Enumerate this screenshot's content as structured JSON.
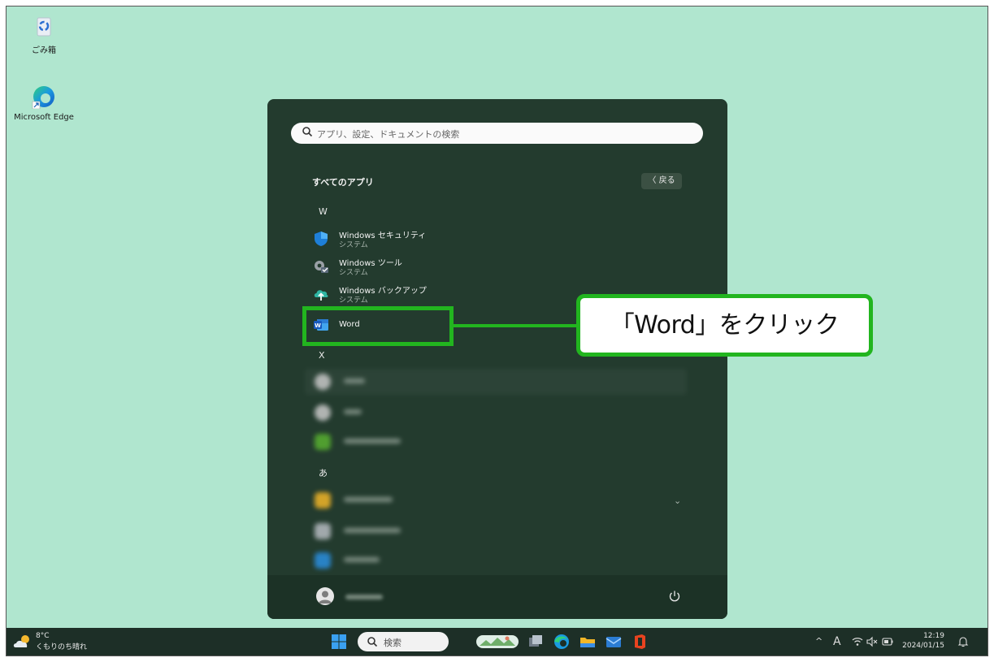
{
  "desktop": {
    "recycle_bin_label": "ごみ箱",
    "edge_label": "Microsoft Edge"
  },
  "start_menu": {
    "search_placeholder": "アプリ、設定、ドキュメントの検索",
    "all_apps_title": "すべてのアプリ",
    "back_label": "〈  戻る",
    "letters": [
      "W",
      "X",
      "あ"
    ],
    "apps": [
      {
        "name": "Windows セキュリティ",
        "sub": "システム"
      },
      {
        "name": "Windows ツール",
        "sub": "システム"
      },
      {
        "name": "Windows バックアップ",
        "sub": "システム"
      },
      {
        "name": "Word",
        "sub": ""
      }
    ]
  },
  "annotation": {
    "callout_text": "「Word」をクリック",
    "color": "#22b51f"
  },
  "taskbar": {
    "temperature": "8°C",
    "weather": "くもりのち晴れ",
    "search_label": "検索",
    "ime": "A",
    "time": "12:19",
    "date": "2024/01/15"
  }
}
